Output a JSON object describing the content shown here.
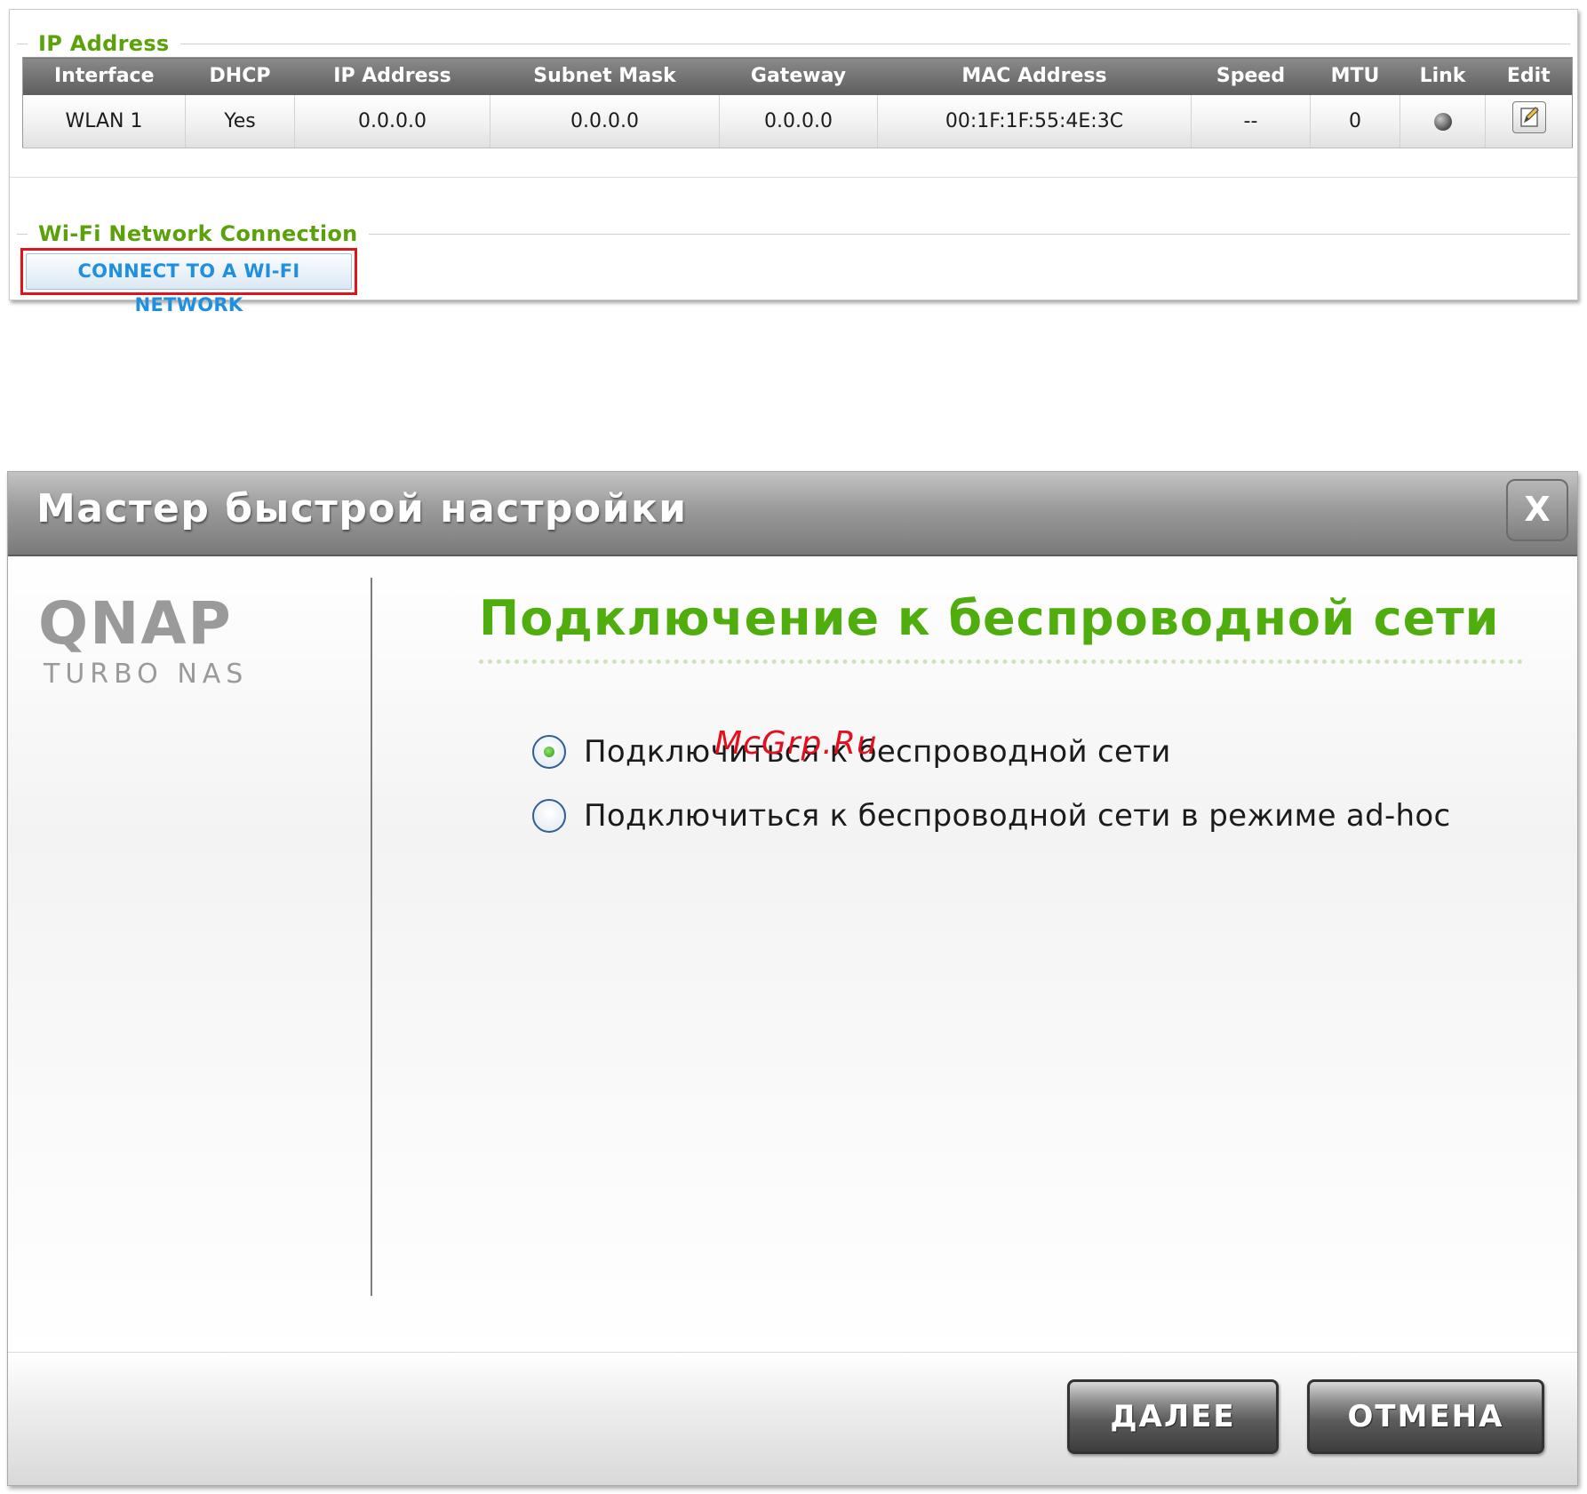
{
  "ip_section": {
    "legend": "IP Address",
    "columns": [
      "Interface",
      "DHCP",
      "IP Address",
      "Subnet Mask",
      "Gateway",
      "MAC Address",
      "Speed",
      "MTU",
      "Link",
      "Edit"
    ],
    "row": {
      "interface": "WLAN 1",
      "dhcp": "Yes",
      "ip": "0.0.0.0",
      "subnet": "0.0.0.0",
      "gateway": "0.0.0.0",
      "mac": "00:1F:1F:55:4E:3C",
      "speed": "--",
      "mtu": "0"
    }
  },
  "wifi_section": {
    "legend": "Wi-Fi Network Connection",
    "connect_button": "CONNECT TO A WI-FI NETWORK",
    "highlight_color": "#e0141b"
  },
  "dialog": {
    "title": "Мастер быстрой настройки",
    "close_label": "X",
    "logo": {
      "brand": "QNAP",
      "product": "TURBO NAS"
    },
    "heading": "Подключение к беспроводной сети",
    "options": [
      {
        "label": "Подключиться к беспроводной сети",
        "selected": true
      },
      {
        "label": "Подключиться к беспроводной сети в режиме ad-hoc",
        "selected": false
      }
    ],
    "next_button": "ДАЛЕЕ",
    "cancel_button": "ОТМЕНА",
    "accent_color": "#4fae0e"
  },
  "watermark": "McGrp.Ru"
}
